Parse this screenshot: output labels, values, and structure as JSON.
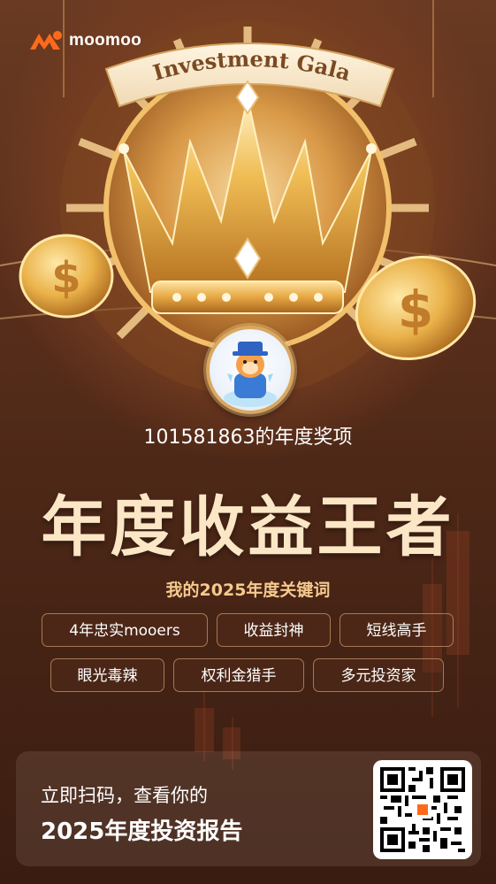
{
  "brand": {
    "name": "moomoo",
    "accent_color": "#ff6a1a",
    "logo_icon": "moomoo-logo-icon"
  },
  "hero": {
    "banner_text": "Investment Gala",
    "crown_icon": "crown-icon",
    "coin_icon": "dollar-coin-icon",
    "avatar_icon": "moomoo-mascot-avatar"
  },
  "award": {
    "user_line": "101581863的年度奖项",
    "title": "年度收益王者"
  },
  "keywords": {
    "heading": "我的2025年度关键词",
    "tags": [
      "4年忠实mooers",
      "收益封神",
      "短线高手",
      "眼光毒辣",
      "权利金猎手",
      "多元投资家"
    ]
  },
  "footer": {
    "line1": "立即扫码，查看你的",
    "line2": "2025年度投资报告",
    "qr_icon": "qr-code"
  },
  "colors": {
    "title_color": "#fbe6c6",
    "heading_color": "#f6c98e",
    "gold": "#e2a94a"
  }
}
